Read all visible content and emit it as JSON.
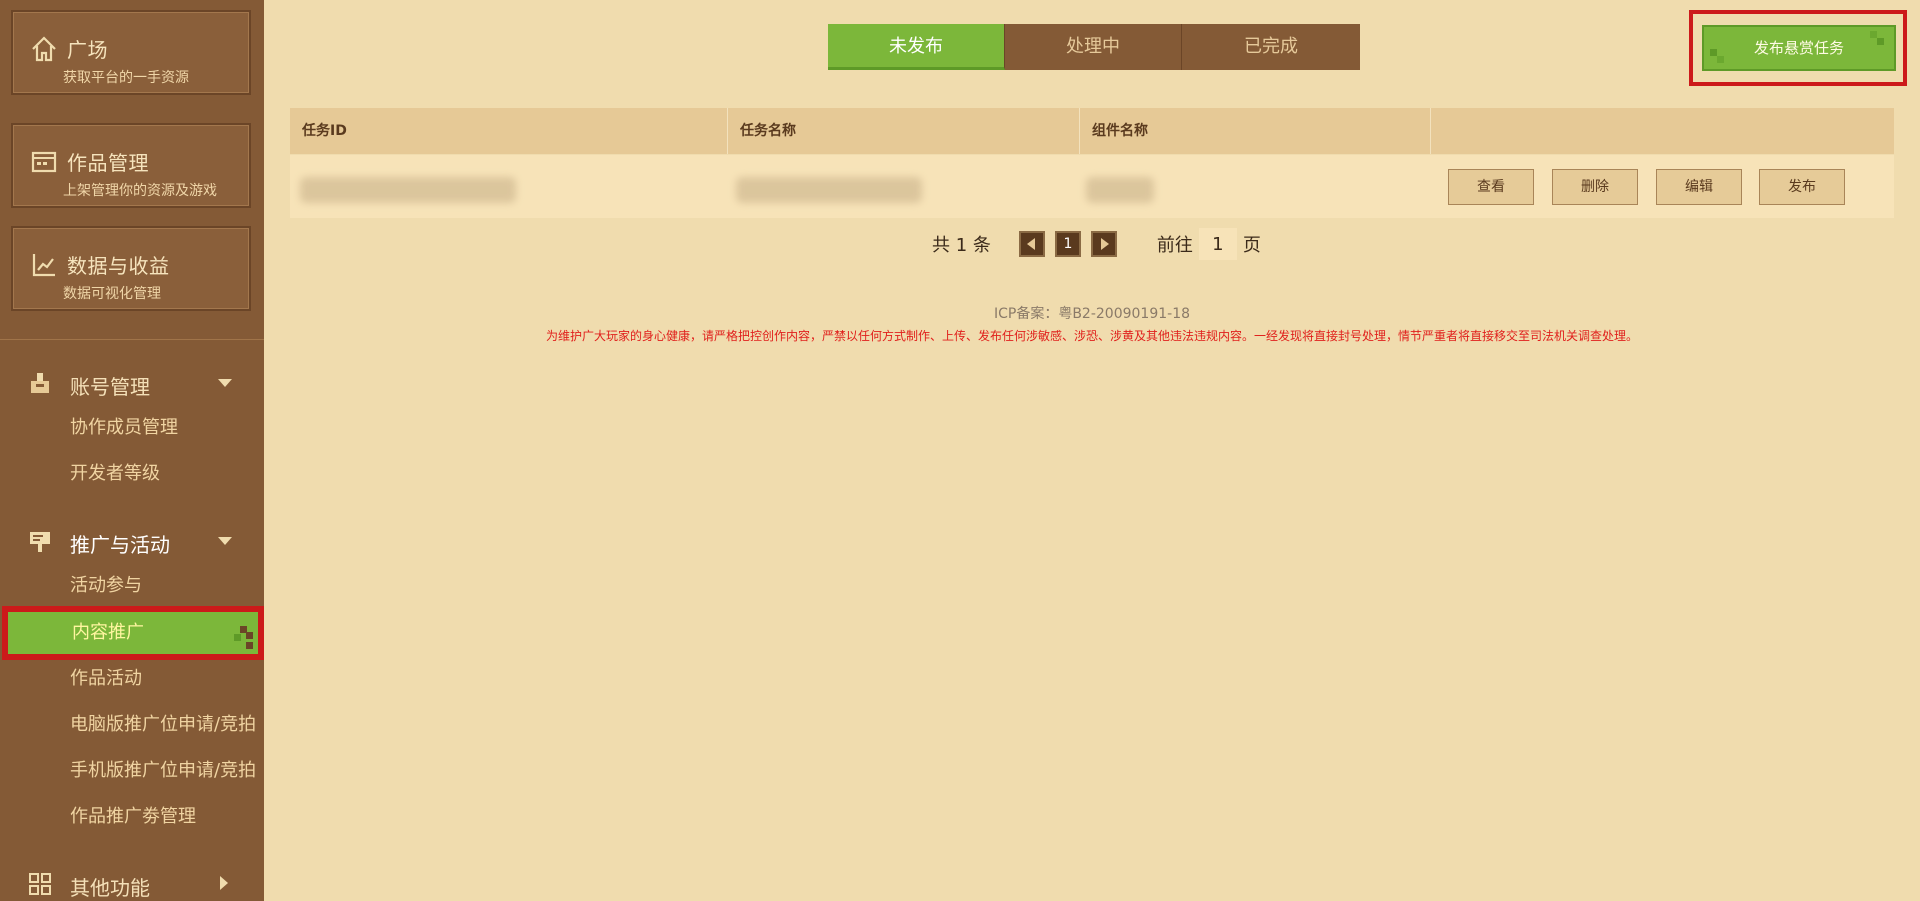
{
  "sidebar": {
    "cards": [
      {
        "title": "广场",
        "subtitle": "获取平台的一手资源",
        "icon": "home-icon"
      },
      {
        "title": "作品管理",
        "subtitle": "上架管理你的资源及游戏",
        "icon": "folder-icon"
      },
      {
        "title": "数据与收益",
        "subtitle": "数据可视化管理",
        "icon": "chart-icon"
      }
    ],
    "groups": [
      {
        "label": "账号管理",
        "icon": "account-icon",
        "items": [
          "协作成员管理",
          "开发者等级"
        ]
      },
      {
        "label": "推广与活动",
        "icon": "sign-icon",
        "items": [
          "活动参与",
          "内容推广",
          "作品活动",
          "电脑版推广位申请/竞拍",
          "手机版推广位申请/竞拍",
          "作品推广劵管理"
        ]
      },
      {
        "label": "其他功能",
        "icon": "grid-icon",
        "items": []
      }
    ],
    "selected_item": "内容推广"
  },
  "main": {
    "tabs": [
      {
        "label": "未发布",
        "active": true
      },
      {
        "label": "处理中",
        "active": false
      },
      {
        "label": "已完成",
        "active": false
      }
    ],
    "publish_button": "发布悬赏任务",
    "table": {
      "columns": [
        "任务ID",
        "任务名称",
        "组件名称",
        ""
      ],
      "actions": [
        "查看",
        "删除",
        "编辑",
        "发布"
      ]
    },
    "pagination": {
      "total": "共 1 条",
      "current_page": "1",
      "goto_label": "前往",
      "goto_value": "1",
      "page_suffix": "页"
    },
    "footer": {
      "icp": "ICP备案：粤B2-20090191-18",
      "warning": "为维护广大玩家的身心健康，请严格把控创作内容，严禁以任何方式制作、上传、发布任何涉敏感、涉恐、涉黄及其他违法违规内容。一经发现将直接封号处理，情节严重者将直接移交至司法机关调查处理。"
    }
  },
  "colors": {
    "sidebar_bg": "#845a36",
    "page_bg": "#f0dcae",
    "accent_green": "#7cb73a",
    "highlight_red": "#cc1a1a"
  }
}
